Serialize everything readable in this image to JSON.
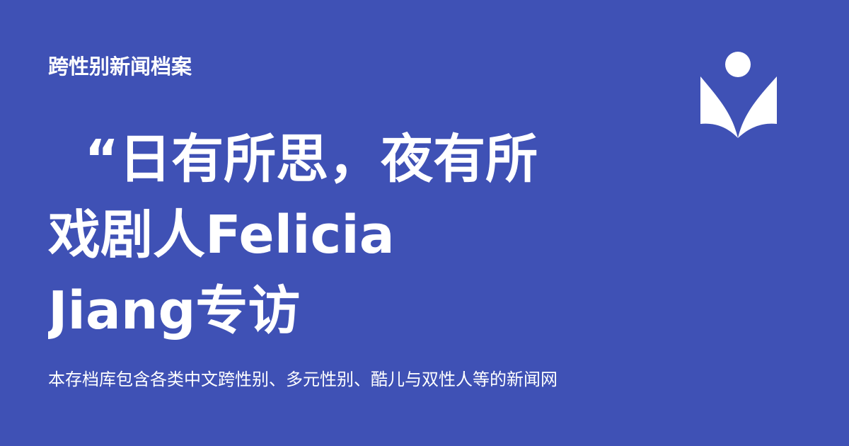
{
  "page": {
    "background_color": "#3f51b5",
    "text_color": "#ffffff"
  },
  "header": {
    "site_name": "跨性别新闻档案"
  },
  "logo": {
    "icon": "open-book-reader-icon"
  },
  "article": {
    "title": "  “日有所思，夜有所\n戏剧人Felicia\nJiang专访",
    "description": "本存档库包含各类中文跨性别、多元性别、酷儿与双性人等的新闻网"
  }
}
